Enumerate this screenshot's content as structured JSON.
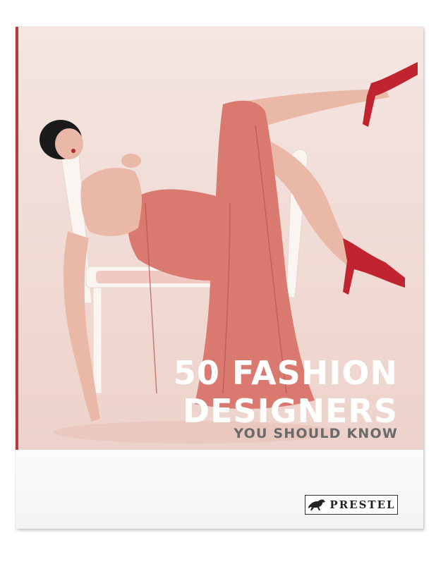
{
  "cover": {
    "title_line1": "50 FASHION",
    "title_line2": "DESIGNERS",
    "subtitle": "YOU SHOULD KNOW",
    "publisher": "PRESTEL"
  },
  "colors": {
    "spine": "#b83a3c",
    "background_photo": "#f2ddd8",
    "dress": "#d9796f",
    "shoes": "#c02431",
    "title": "#ffffff",
    "subtitle": "#6a6a6a"
  },
  "icons": {
    "publisher_logo": "horse-logo-icon"
  }
}
